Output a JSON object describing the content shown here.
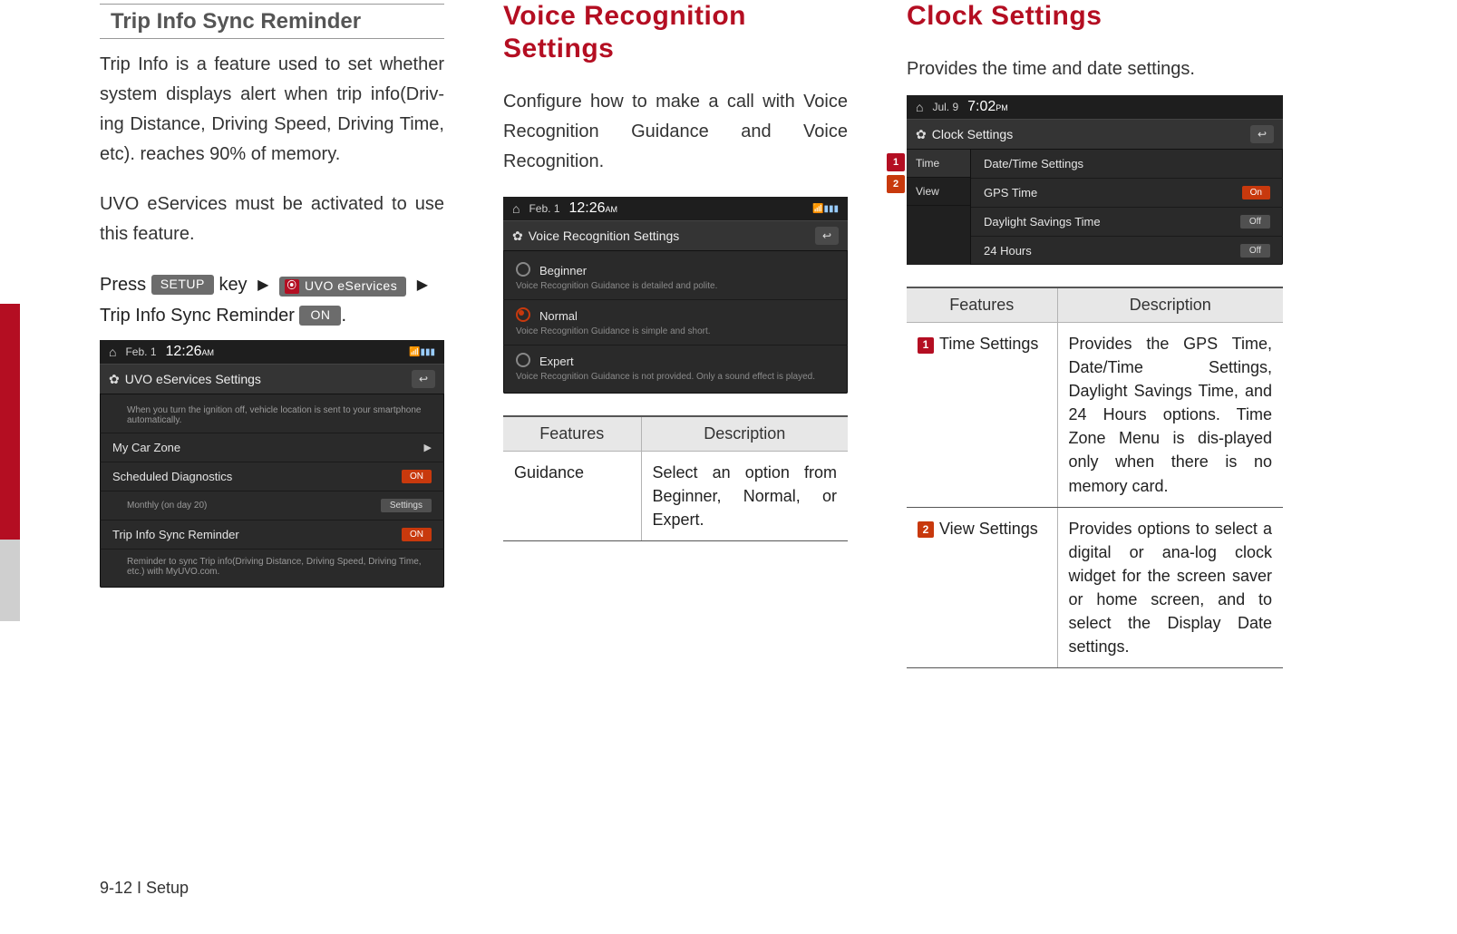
{
  "footer": "9-12 I Setup",
  "col1": {
    "subhead": "Trip Info Sync Reminder",
    "para1": "Trip Info is a feature used to set whether system displays alert when trip info(Driv-ing Distance, Driving Speed, Driving Time, etc). reaches 90% of memory.",
    "para2": "UVO eServices must be activated to use this feature.",
    "press": {
      "press": "Press",
      "setup": "SETUP",
      "key": "key",
      "uvo": "UVO eServices",
      "line2_pre": "Trip Info Sync Reminder",
      "on": "ON"
    },
    "screenshot": {
      "date": "Feb.  1",
      "time": "12:26",
      "ampm": "AM",
      "title": "UVO eServices Settings",
      "row0_sub": "When you turn the ignition off, vehicle location is sent to your smartphone automatically.",
      "row1": "My Car Zone",
      "row2": "Scheduled Diagnostics",
      "row2_on": "ON",
      "row2_sub": "Monthly (on day 20)",
      "row2_settings": "Settings",
      "row3": "Trip Info Sync Reminder",
      "row3_on": "ON",
      "row3_sub": "Reminder to sync Trip info(Driving Distance, Driving Speed, Driving Time, etc.) with MyUVO.com."
    }
  },
  "col2": {
    "title": "Voice Recognition Settings",
    "para1": "Configure how to make a call with Voice Recognition Guidance and Voice Recognition.",
    "screenshot": {
      "date": "Feb.  1",
      "time": "12:26",
      "ampm": "AM",
      "title": "Voice Recognition Settings",
      "opt1": "Beginner",
      "opt1_sub": "Voice Recognition Guidance is detailed and polite.",
      "opt2": "Normal",
      "opt2_sub": "Voice Recognition Guidance is simple and short.",
      "opt3": "Expert",
      "opt3_sub": "Voice Recognition Guidance is not provided. Only a sound effect is played."
    },
    "table": {
      "h1": "Features",
      "h2": "Description",
      "r1f": "Guidance",
      "r1d": "Select an option from Beginner, Normal, or Expert."
    }
  },
  "col3": {
    "title": "Clock Settings",
    "para1": "Provides the time and date settings.",
    "screenshot": {
      "date": "Jul.  9",
      "time": "7:02",
      "ampm": "PM",
      "title": "Clock Settings",
      "left1": "Time",
      "left2": "View",
      "r1": "Date/Time Settings",
      "r2": "GPS Time",
      "r2_chip": "On",
      "r3": "Daylight Savings Time",
      "r3_chip": "Off",
      "r4": "24 Hours",
      "r4_chip": "Off",
      "tab1": "1",
      "tab2": "2"
    },
    "table": {
      "h1": "Features",
      "h2": "Description",
      "r1_num": "1",
      "r1_f": "Time Settings",
      "r1_d": "Provides the GPS Time, Date/Time Settings, Daylight Savings Time, and 24 Hours options. Time Zone Menu is dis-played only when there is no memory card.",
      "r2_num": "2",
      "r2_f": "View Settings",
      "r2_d": "Provides options to select a digital or ana-log clock widget for the screen saver or home screen, and to select the Display Date settings."
    }
  }
}
